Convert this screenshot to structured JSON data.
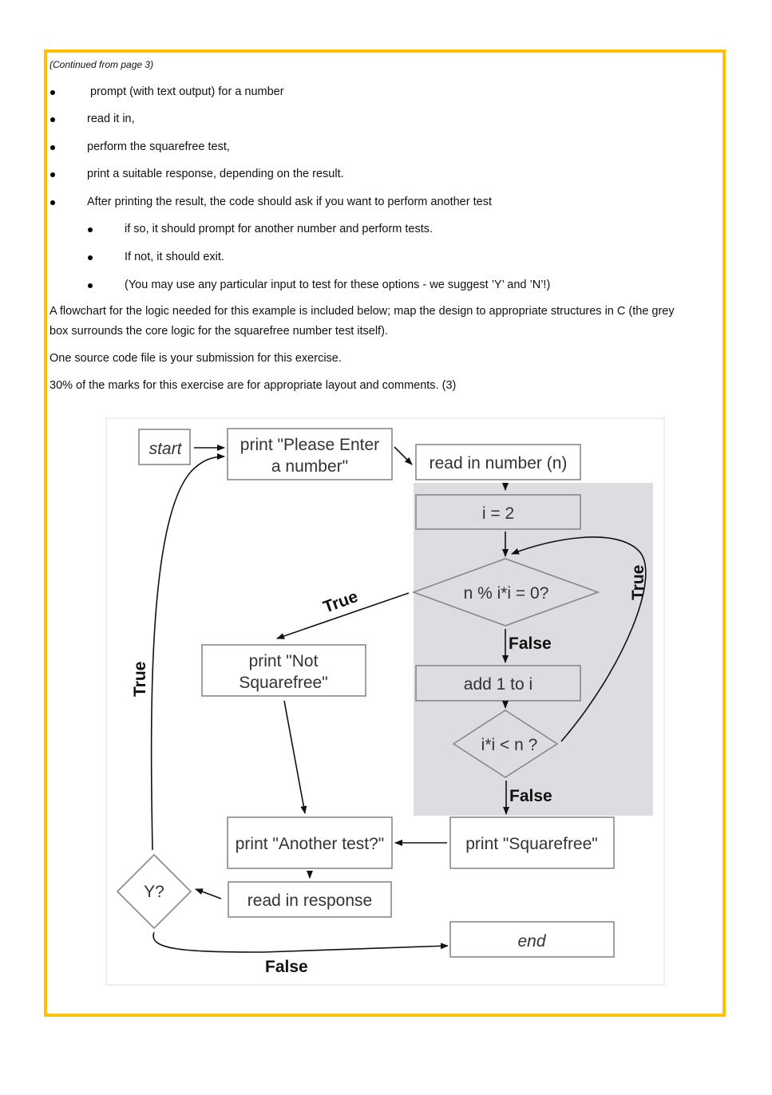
{
  "continued": "(Continued from page 3)",
  "bullets": [
    "prompt (with text output) for a number",
    "read it in,",
    "perform the squarefree test,",
    "print a suitable response, depending on the result.",
    "After printing the result, the code should ask if you want to perform another test"
  ],
  "sub_bullets": [
    "if so, it should prompt for another number and perform tests.",
    "If not, it should exit.",
    "(You may use any particular input to test for these options - we suggest ’Y’ and ’N’!)"
  ],
  "paragraphs": [
    "A flowchart for the logic needed for this example is included below; map the design to appropriate structures in C (the grey",
    "box surrounds the core logic for the squarefree number test itself).",
    "One source code file is your submission for this exercise.",
    "30% of the marks for this exercise are for appropriate layout and comments. (3)"
  ],
  "border_color": "#FFC000",
  "flowchart": {
    "start": "start",
    "print_enter": [
      "print \"Please Enter",
      "a number\""
    ],
    "read_n": "read in number (n)",
    "i_eq_2": "i = 2",
    "cond_mod": "n  % i*i = 0?",
    "add_one": "add 1 to i",
    "cond_less": "i*i < n ?",
    "print_not": [
      "print \"Not",
      "Squarefree\""
    ],
    "print_another": "print \"Another test?\"",
    "print_sq": "print \"Squarefree\"",
    "read_response": "read in response",
    "cond_y": "Y?",
    "end": "end",
    "label_true": "True",
    "label_false": "False",
    "grey_color": "#dcdde0"
  }
}
